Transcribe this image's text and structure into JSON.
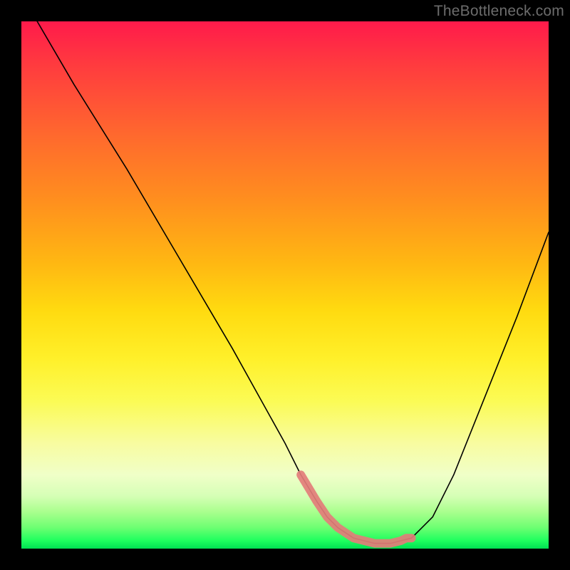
{
  "watermark": "TheBottleneck.com",
  "chart_data": {
    "type": "line",
    "title": "",
    "xlabel": "",
    "ylabel": "",
    "xlim": [
      0,
      100
    ],
    "ylim": [
      0,
      100
    ],
    "grid": false,
    "legend": false,
    "series": [
      {
        "name": "curve",
        "style": "thin-black",
        "x": [
          3,
          10,
          20,
          30,
          40,
          50,
          53,
          56,
          58,
          60,
          63,
          67,
          70,
          74,
          78,
          82,
          86,
          90,
          94,
          100
        ],
        "y": [
          100,
          88,
          72,
          55,
          38,
          20,
          14,
          9,
          6,
          4,
          2,
          1,
          1,
          2,
          6,
          14,
          24,
          34,
          44,
          60
        ]
      },
      {
        "name": "highlight-segment",
        "style": "thick-pink",
        "x": [
          53,
          56,
          58,
          60,
          63,
          67,
          70,
          72,
          73,
          74
        ],
        "y": [
          14,
          9,
          6,
          4,
          2,
          1,
          1,
          1.5,
          2,
          2
        ]
      }
    ],
    "colors": {
      "curve": "#000000",
      "highlight": "#e37d7a",
      "gradient_top": "#ff1a4b",
      "gradient_mid": "#ffdb10",
      "gradient_bottom": "#00e052",
      "frame": "#000000"
    }
  }
}
